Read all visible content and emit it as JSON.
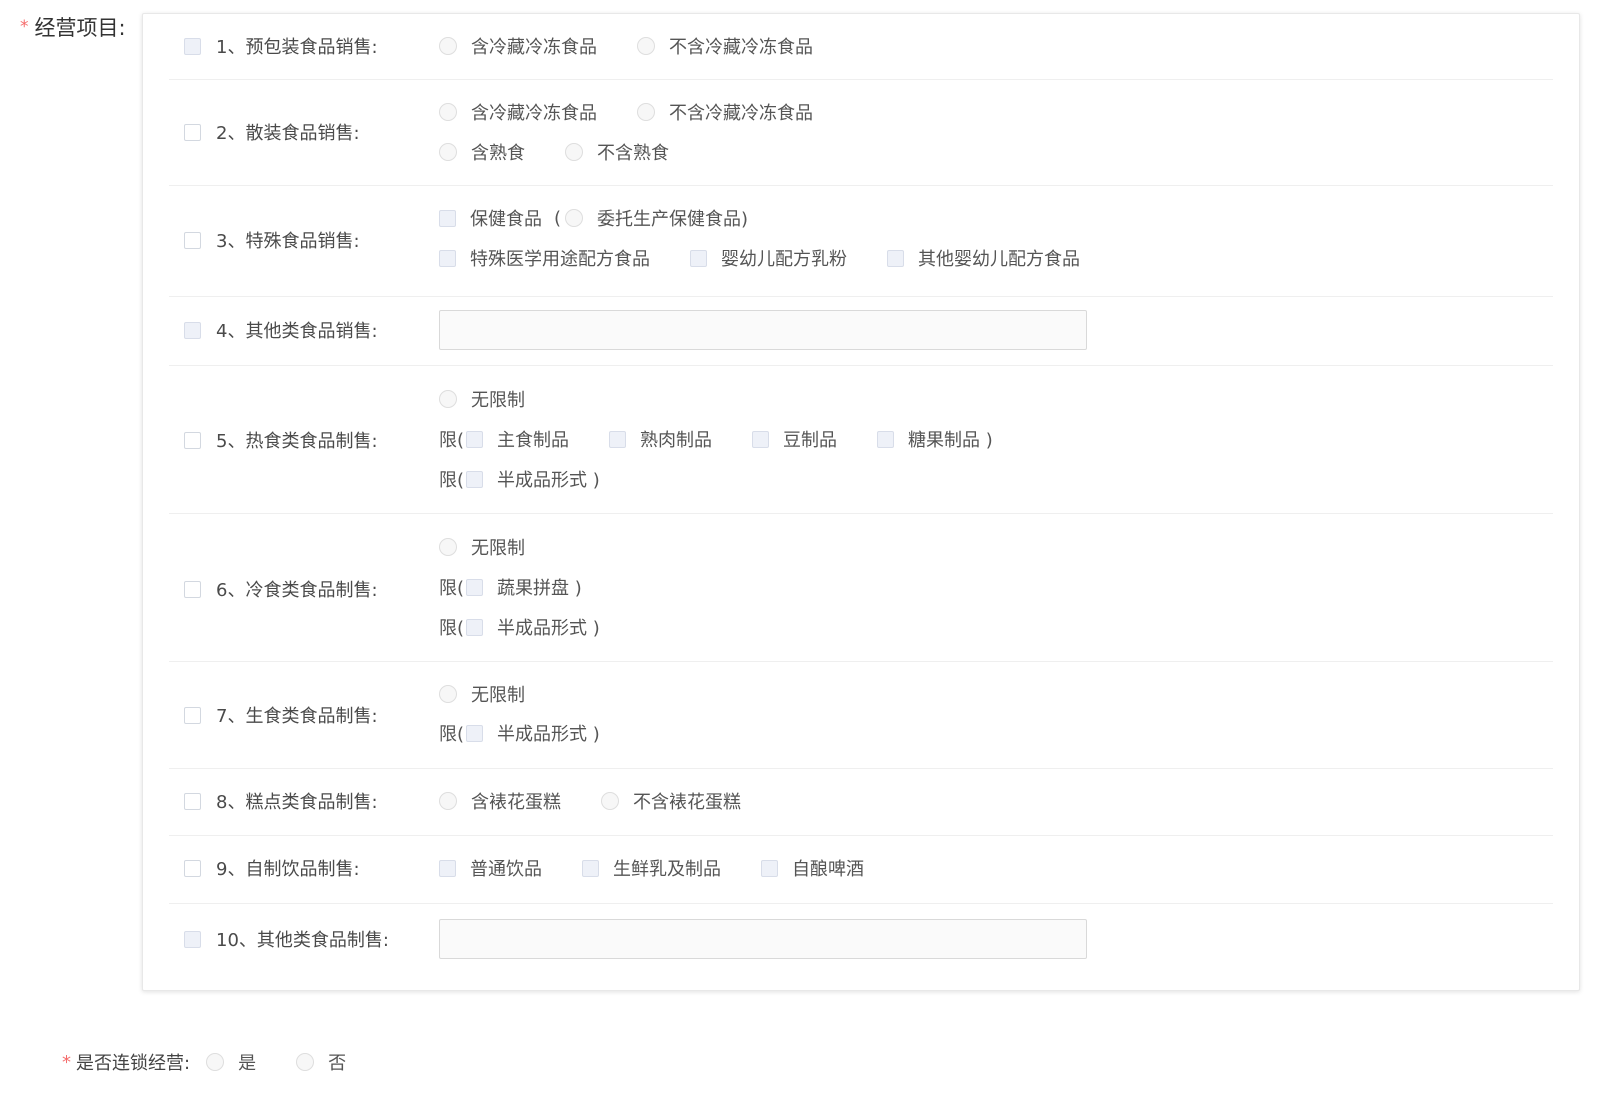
{
  "form": {
    "required_mark": "*",
    "label": "经营项目:",
    "rows": [
      {
        "title": "1、预包装食品销售:",
        "options": [
          "含冷藏冷冻食品",
          "不含冷藏冷冻食品"
        ]
      },
      {
        "title": "2、散装食品销售:",
        "line1": [
          "含冷藏冷冻食品",
          "不含冷藏冷冻食品"
        ],
        "line2": [
          "含熟食",
          "不含熟食"
        ]
      },
      {
        "title": "3、特殊食品销售:",
        "line1": {
          "checkbox": "保健食品",
          "paren_open": "(",
          "radio": "委托生产保健食品)"
        },
        "line2": [
          "特殊医学用途配方食品",
          "婴幼儿配方乳粉",
          "其他婴幼儿配方食品"
        ]
      },
      {
        "title": "4、其他类食品销售:",
        "input_value": ""
      },
      {
        "title": "5、热食类食品制售:",
        "unlimited": "无限制",
        "limit_prefix": "限(",
        "line2": [
          "主食制品",
          "熟肉制品",
          "豆制品",
          "糖果制品 )"
        ],
        "line3": [
          "半成品形式 )"
        ]
      },
      {
        "title": "6、冷食类食品制售:",
        "unlimited": "无限制",
        "limit_prefix": "限(",
        "line2": [
          "蔬果拼盘 )"
        ],
        "line3": [
          "半成品形式 )"
        ]
      },
      {
        "title": "7、生食类食品制售:",
        "unlimited": "无限制",
        "limit_prefix": "限(",
        "line2": [
          "半成品形式 )"
        ]
      },
      {
        "title": "8、糕点类食品制售:",
        "options": [
          "含裱花蛋糕",
          "不含裱花蛋糕"
        ]
      },
      {
        "title": "9、自制饮品制售:",
        "options": [
          "普通饮品",
          "生鲜乳及制品",
          "自酿啤酒"
        ]
      },
      {
        "title": "10、其他类食品制售:",
        "input_value": ""
      }
    ]
  },
  "chain": {
    "required_mark": "*",
    "label": "是否连锁经营:",
    "options": [
      "是",
      "否"
    ]
  }
}
